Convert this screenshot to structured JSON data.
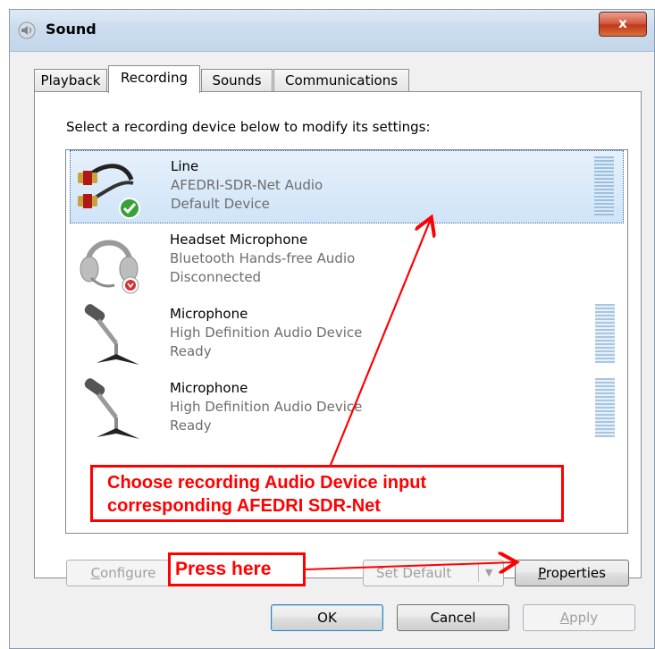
{
  "window": {
    "title": "Sound",
    "close_glyph": "x"
  },
  "tabs": [
    {
      "label": "Playback"
    },
    {
      "label": "Recording"
    },
    {
      "label": "Sounds"
    },
    {
      "label": "Communications"
    }
  ],
  "active_tab": "Recording",
  "instruction": "Select a recording device below to modify its settings:",
  "devices": [
    {
      "name": "Line",
      "description": "AFEDRI-SDR-Net Audio",
      "status": "Default Device",
      "icon": "line-in-icon",
      "badge": "check-badge-icon",
      "selected": true
    },
    {
      "name": "Headset Microphone",
      "description": "Bluetooth Hands-free Audio",
      "status": "Disconnected",
      "icon": "headset-icon",
      "badge": "disconnected-badge-icon",
      "selected": false
    },
    {
      "name": "Microphone",
      "description": "High Definition Audio Device",
      "status": "Ready",
      "icon": "microphone-icon",
      "selected": false
    },
    {
      "name": "Microphone",
      "description": "High Definition Audio Device",
      "status": "Ready",
      "icon": "microphone-icon",
      "selected": false
    }
  ],
  "buttons": {
    "configure": {
      "mnemonic": "C",
      "rest": "onfigure",
      "enabled": false
    },
    "set_default": {
      "label": "Set Default",
      "enabled": false
    },
    "properties": {
      "mnemonic": "P",
      "rest": "roperties",
      "enabled": true
    },
    "ok": "OK",
    "cancel": "Cancel",
    "apply": {
      "mnemonic": "A",
      "rest": "pply",
      "enabled": false
    }
  },
  "annotations": {
    "main_line1": "Choose recording Audio Device input",
    "main_line2": "corresponding AFEDRI SDR-Net",
    "press": "Press here",
    "color": "#ff0000"
  },
  "colors": {
    "selection": "#cfe4f8",
    "close_button": "#c2391b",
    "annotation": "#ff0000"
  }
}
